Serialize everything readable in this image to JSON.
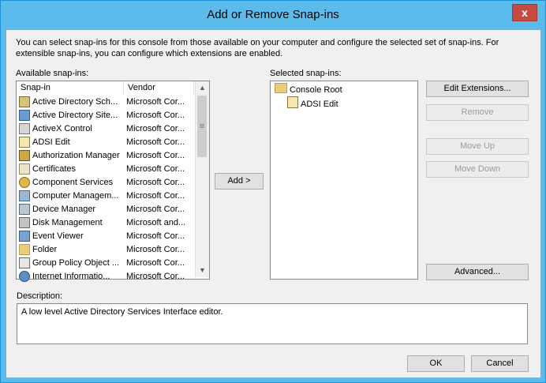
{
  "dialog": {
    "title": "Add or Remove Snap-ins",
    "close_glyph": "x"
  },
  "intro_text": "You can select snap-ins for this console from those available on your computer and configure the selected set of snap-ins. For extensible snap-ins, you can configure which extensions are enabled.",
  "available": {
    "label": "Available snap-ins:",
    "columns": {
      "snapin": "Snap-in",
      "vendor": "Vendor"
    },
    "items": [
      {
        "name": "Active Directory Sch...",
        "vendor": "Microsoft Cor...",
        "icon": "ad-schema-icon"
      },
      {
        "name": "Active Directory Site...",
        "vendor": "Microsoft Cor...",
        "icon": "ad-sites-icon"
      },
      {
        "name": "ActiveX Control",
        "vendor": "Microsoft Cor...",
        "icon": "activex-icon"
      },
      {
        "name": "ADSI Edit",
        "vendor": "Microsoft Cor...",
        "icon": "adsi-edit-icon"
      },
      {
        "name": "Authorization Manager",
        "vendor": "Microsoft Cor...",
        "icon": "authorization-icon"
      },
      {
        "name": "Certificates",
        "vendor": "Microsoft Cor...",
        "icon": "certificate-icon"
      },
      {
        "name": "Component Services",
        "vendor": "Microsoft Cor...",
        "icon": "component-services-icon"
      },
      {
        "name": "Computer Managem...",
        "vendor": "Microsoft Cor...",
        "icon": "computer-management-icon"
      },
      {
        "name": "Device Manager",
        "vendor": "Microsoft Cor...",
        "icon": "device-manager-icon"
      },
      {
        "name": "Disk Management",
        "vendor": "Microsoft and...",
        "icon": "disk-icon"
      },
      {
        "name": "Event Viewer",
        "vendor": "Microsoft Cor...",
        "icon": "event-viewer-icon"
      },
      {
        "name": "Folder",
        "vendor": "Microsoft Cor...",
        "icon": "folder-icon"
      },
      {
        "name": "Group Policy Object ...",
        "vendor": "Microsoft Cor...",
        "icon": "group-policy-icon"
      },
      {
        "name": "Internet Informatio...",
        "vendor": "Microsoft Cor...",
        "icon": "iis-icon"
      }
    ]
  },
  "add_button": "Add >",
  "selected": {
    "label": "Selected snap-ins:",
    "root": "Console Root",
    "child": "ADSI Edit"
  },
  "buttons": {
    "edit_extensions": "Edit Extensions...",
    "remove": "Remove",
    "move_up": "Move Up",
    "move_down": "Move Down",
    "advanced": "Advanced...",
    "ok": "OK",
    "cancel": "Cancel"
  },
  "description": {
    "label": "Description:",
    "text": "A low level Active Directory Services Interface editor."
  },
  "colors": {
    "title_bar": "#5bbcec",
    "close_button": "#c74a40",
    "dialog_bg": "#f0f0f0"
  }
}
